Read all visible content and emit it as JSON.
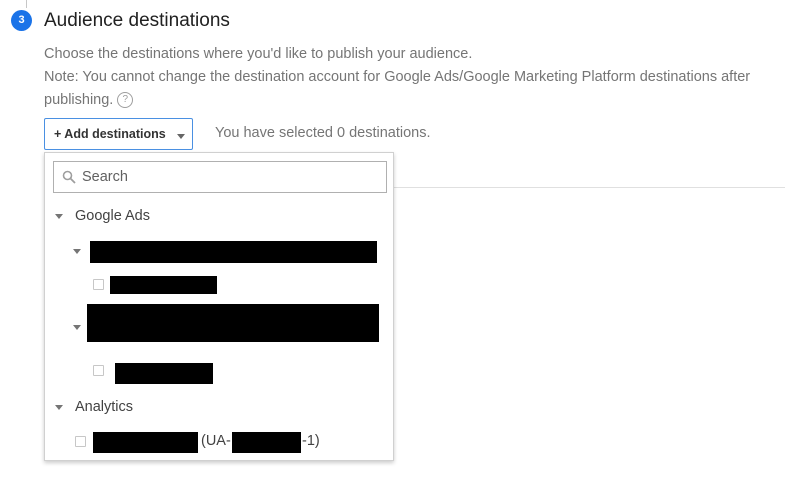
{
  "section": {
    "step_number": "3",
    "title": "Audience destinations",
    "description_line1": "Choose the destinations where you'd like to publish your audience.",
    "description_line2": "Note: You cannot change the destination account for Google Ads/Google Marketing Platform destinations after publishing."
  },
  "toolbar": {
    "add_label": "+ Add destinations",
    "selected_text": "You have selected 0 destinations."
  },
  "dropdown": {
    "search": {
      "placeholder": "Search",
      "value": ""
    },
    "groups": [
      {
        "label": "Google Ads",
        "expanded": true
      },
      {
        "label": "Analytics",
        "expanded": true
      }
    ],
    "analytics_item": {
      "prefix": "(UA-",
      "suffix": "-1)"
    }
  },
  "colors": {
    "accent": "#1a73e8",
    "button_border": "#4a90e2",
    "muted_text": "#757575"
  },
  "icons": {
    "help": "question-circle-icon",
    "search": "magnifier-icon",
    "expand": "triangle-down-icon"
  }
}
